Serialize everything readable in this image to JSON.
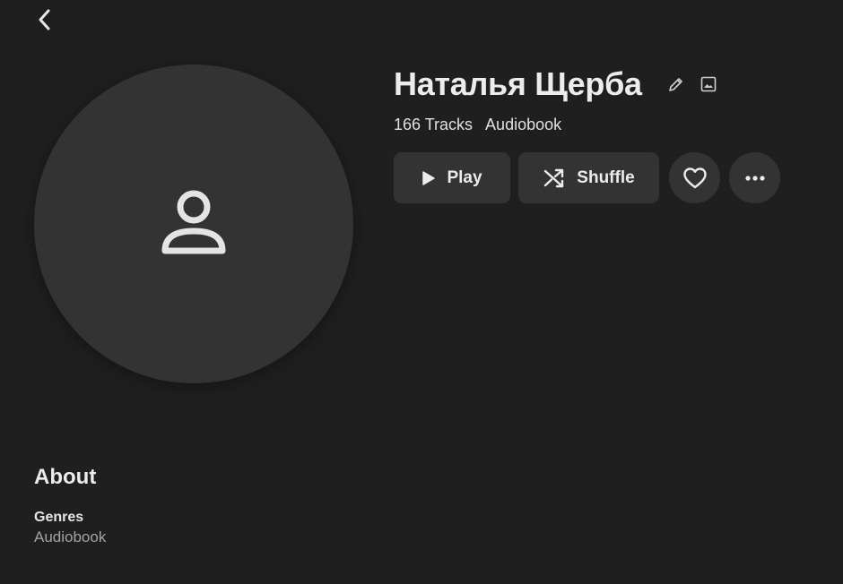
{
  "artist": {
    "name": "Наталья Щерба",
    "track_count": "166 Tracks",
    "category": "Audiobook"
  },
  "actions": {
    "play_label": "Play",
    "shuffle_label": "Shuffle"
  },
  "about": {
    "title": "About",
    "genres_label": "Genres",
    "genres_value": "Audiobook"
  },
  "icons": {
    "back": "chevron-left-icon",
    "avatar": "person-icon",
    "edit": "pencil-icon",
    "image": "image-icon",
    "play": "play-icon",
    "shuffle": "shuffle-icon",
    "like": "heart-icon",
    "more": "more-horizontal-icon"
  },
  "colors": {
    "background": "#1f1f1f",
    "surface": "#333333",
    "text": "#ececec",
    "muted": "#a3a3a3"
  }
}
